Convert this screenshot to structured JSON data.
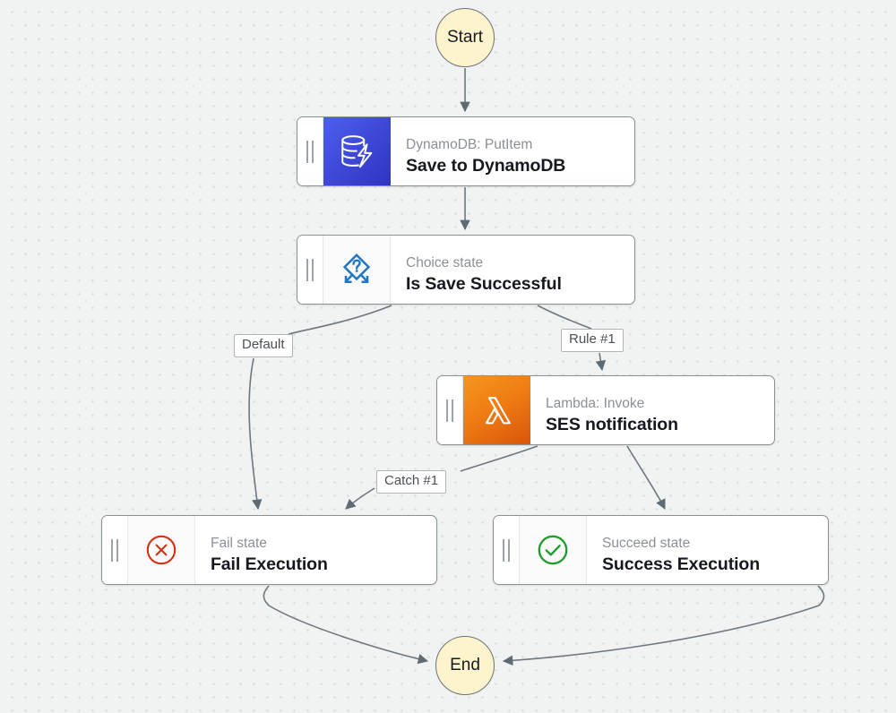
{
  "diagram": {
    "type": "aws-step-functions-workflow",
    "background_color": "#f1f3f3",
    "terminals": {
      "start_label": "Start",
      "end_label": "End",
      "fill_color": "#fdf4cd",
      "border_color": "#6b7278"
    },
    "nodes": [
      {
        "id": "save-to-dynamodb",
        "subtitle": "DynamoDB: PutItem",
        "title": "Save to DynamoDB",
        "icon": "dynamodb-icon",
        "icon_color": "#3f49d8"
      },
      {
        "id": "is-save-successful",
        "subtitle": "Choice state",
        "title": "Is Save Successful",
        "icon": "choice-state-icon",
        "icon_color": "#1f77c4"
      },
      {
        "id": "ses-notification",
        "subtitle": "Lambda: Invoke",
        "title": "SES notification",
        "icon": "lambda-icon",
        "icon_color": "#ef7d13"
      },
      {
        "id": "fail-execution",
        "subtitle": "Fail state",
        "title": "Fail Execution",
        "icon": "fail-state-icon",
        "icon_color": "#d13212"
      },
      {
        "id": "success-execution",
        "subtitle": "Succeed state",
        "title": "Success Execution",
        "icon": "succeed-state-icon",
        "icon_color": "#1d9d28"
      }
    ],
    "edge_labels": {
      "default": "Default",
      "rule1": "Rule #1",
      "catch1": "Catch #1"
    },
    "edges": [
      {
        "from": "Start",
        "to": "Save to DynamoDB",
        "label": ""
      },
      {
        "from": "Save to DynamoDB",
        "to": "Is Save Successful",
        "label": ""
      },
      {
        "from": "Is Save Successful",
        "to": "Fail Execution",
        "label": "Default"
      },
      {
        "from": "Is Save Successful",
        "to": "SES notification",
        "label": "Rule #1"
      },
      {
        "from": "SES notification",
        "to": "Fail Execution",
        "label": "Catch #1"
      },
      {
        "from": "SES notification",
        "to": "Success Execution",
        "label": ""
      },
      {
        "from": "Fail Execution",
        "to": "End",
        "label": ""
      },
      {
        "from": "Success Execution",
        "to": "End",
        "label": ""
      }
    ]
  }
}
